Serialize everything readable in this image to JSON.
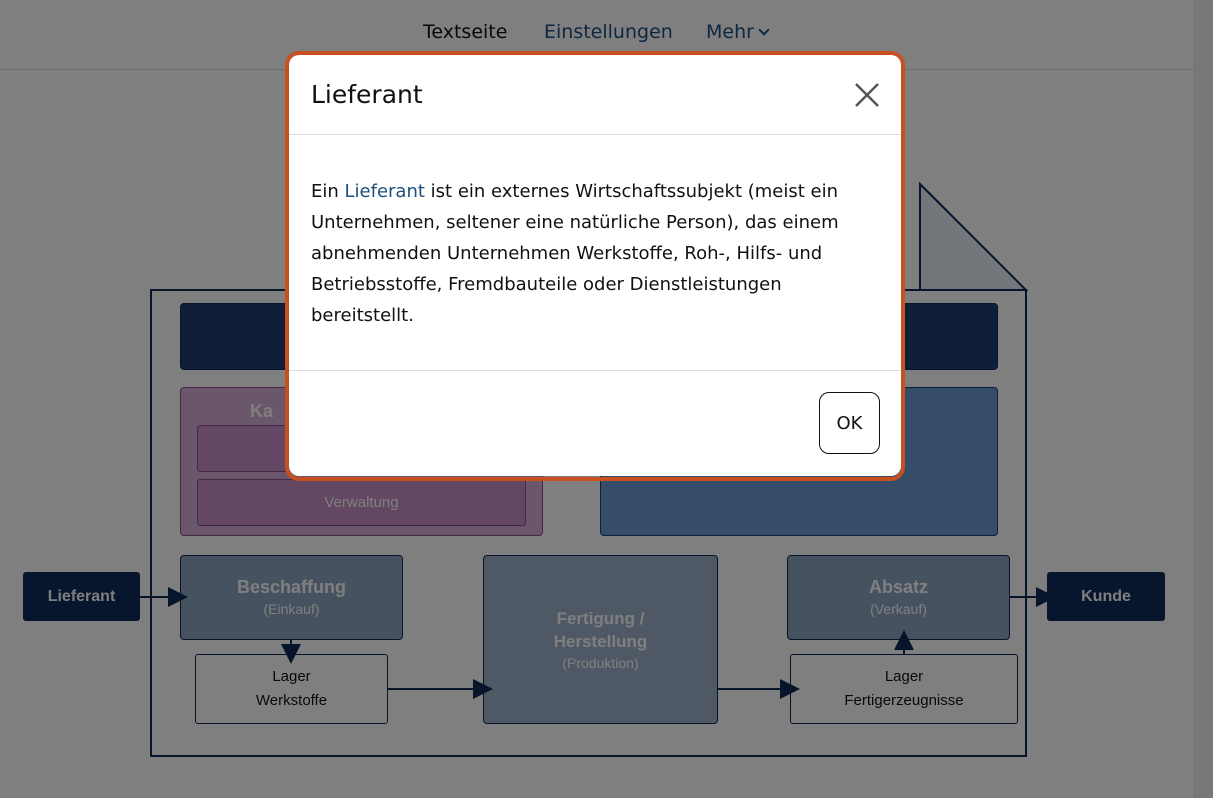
{
  "nav": {
    "current": "Textseite",
    "settings": "Einstellungen",
    "more": "Mehr"
  },
  "diagram": {
    "left_endpoint": "Lieferant",
    "right_endpoint": "Kunde",
    "purple_title_partial": "Ka",
    "verwaltung": "Verwaltung",
    "beschaffung_title": "Beschaffung",
    "beschaffung_sub": "(Einkauf)",
    "lager_werkstoffe_1": "Lager",
    "lager_werkstoffe_2": "Werkstoffe",
    "fertigung_title_1": "Fertigung /",
    "fertigung_title_2": "Herstellung",
    "fertigung_sub": "(Produktion)",
    "absatz_title": "Absatz",
    "absatz_sub": "(Verkauf)",
    "lager_fertig_1": "Lager",
    "lager_fertig_2": "Fertigerzeugnisse"
  },
  "modal": {
    "title": "Lieferant",
    "body_prefix": "Ein ",
    "body_term": "Lieferant",
    "body_rest": " ist ein externes Wirtschaftssubjekt (meist ein Unternehmen, seltener eine natürliche Person), das einem abnehmenden Unternehmen Werkstoffe, Roh-, Hilfs- und Betriebsstoffe, Fremdbauteile oder Dienstleistungen bereitstellt.",
    "ok_label": "OK"
  },
  "colors": {
    "accent_ring": "#c6501f",
    "link": "#1d4f7d",
    "diagram_dark": "#1f3f73"
  }
}
